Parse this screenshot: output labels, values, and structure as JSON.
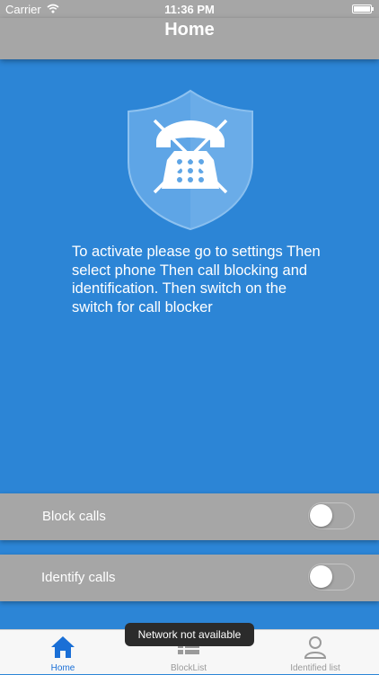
{
  "status": {
    "carrier": "Carrier",
    "time": "11:36 PM"
  },
  "nav": {
    "title": "Home"
  },
  "instructions": "To activate please go to settings Then select phone Then call blocking and identification. Then switch on the switch for call blocker",
  "toggles": {
    "block": {
      "label": "Block calls",
      "on": false
    },
    "identify": {
      "label": "Identify calls",
      "on": false
    }
  },
  "tabs": [
    {
      "label": "Home",
      "icon": "home-icon",
      "selected": true
    },
    {
      "label": "BlockList",
      "icon": "list-icon",
      "selected": false
    },
    {
      "label": "Identified list",
      "icon": "person-icon",
      "selected": false
    }
  ],
  "toast": "Network not available",
  "colors": {
    "background": "#2c85d6",
    "bars": "#a6a6a6",
    "accent": "#1a6fd6"
  }
}
